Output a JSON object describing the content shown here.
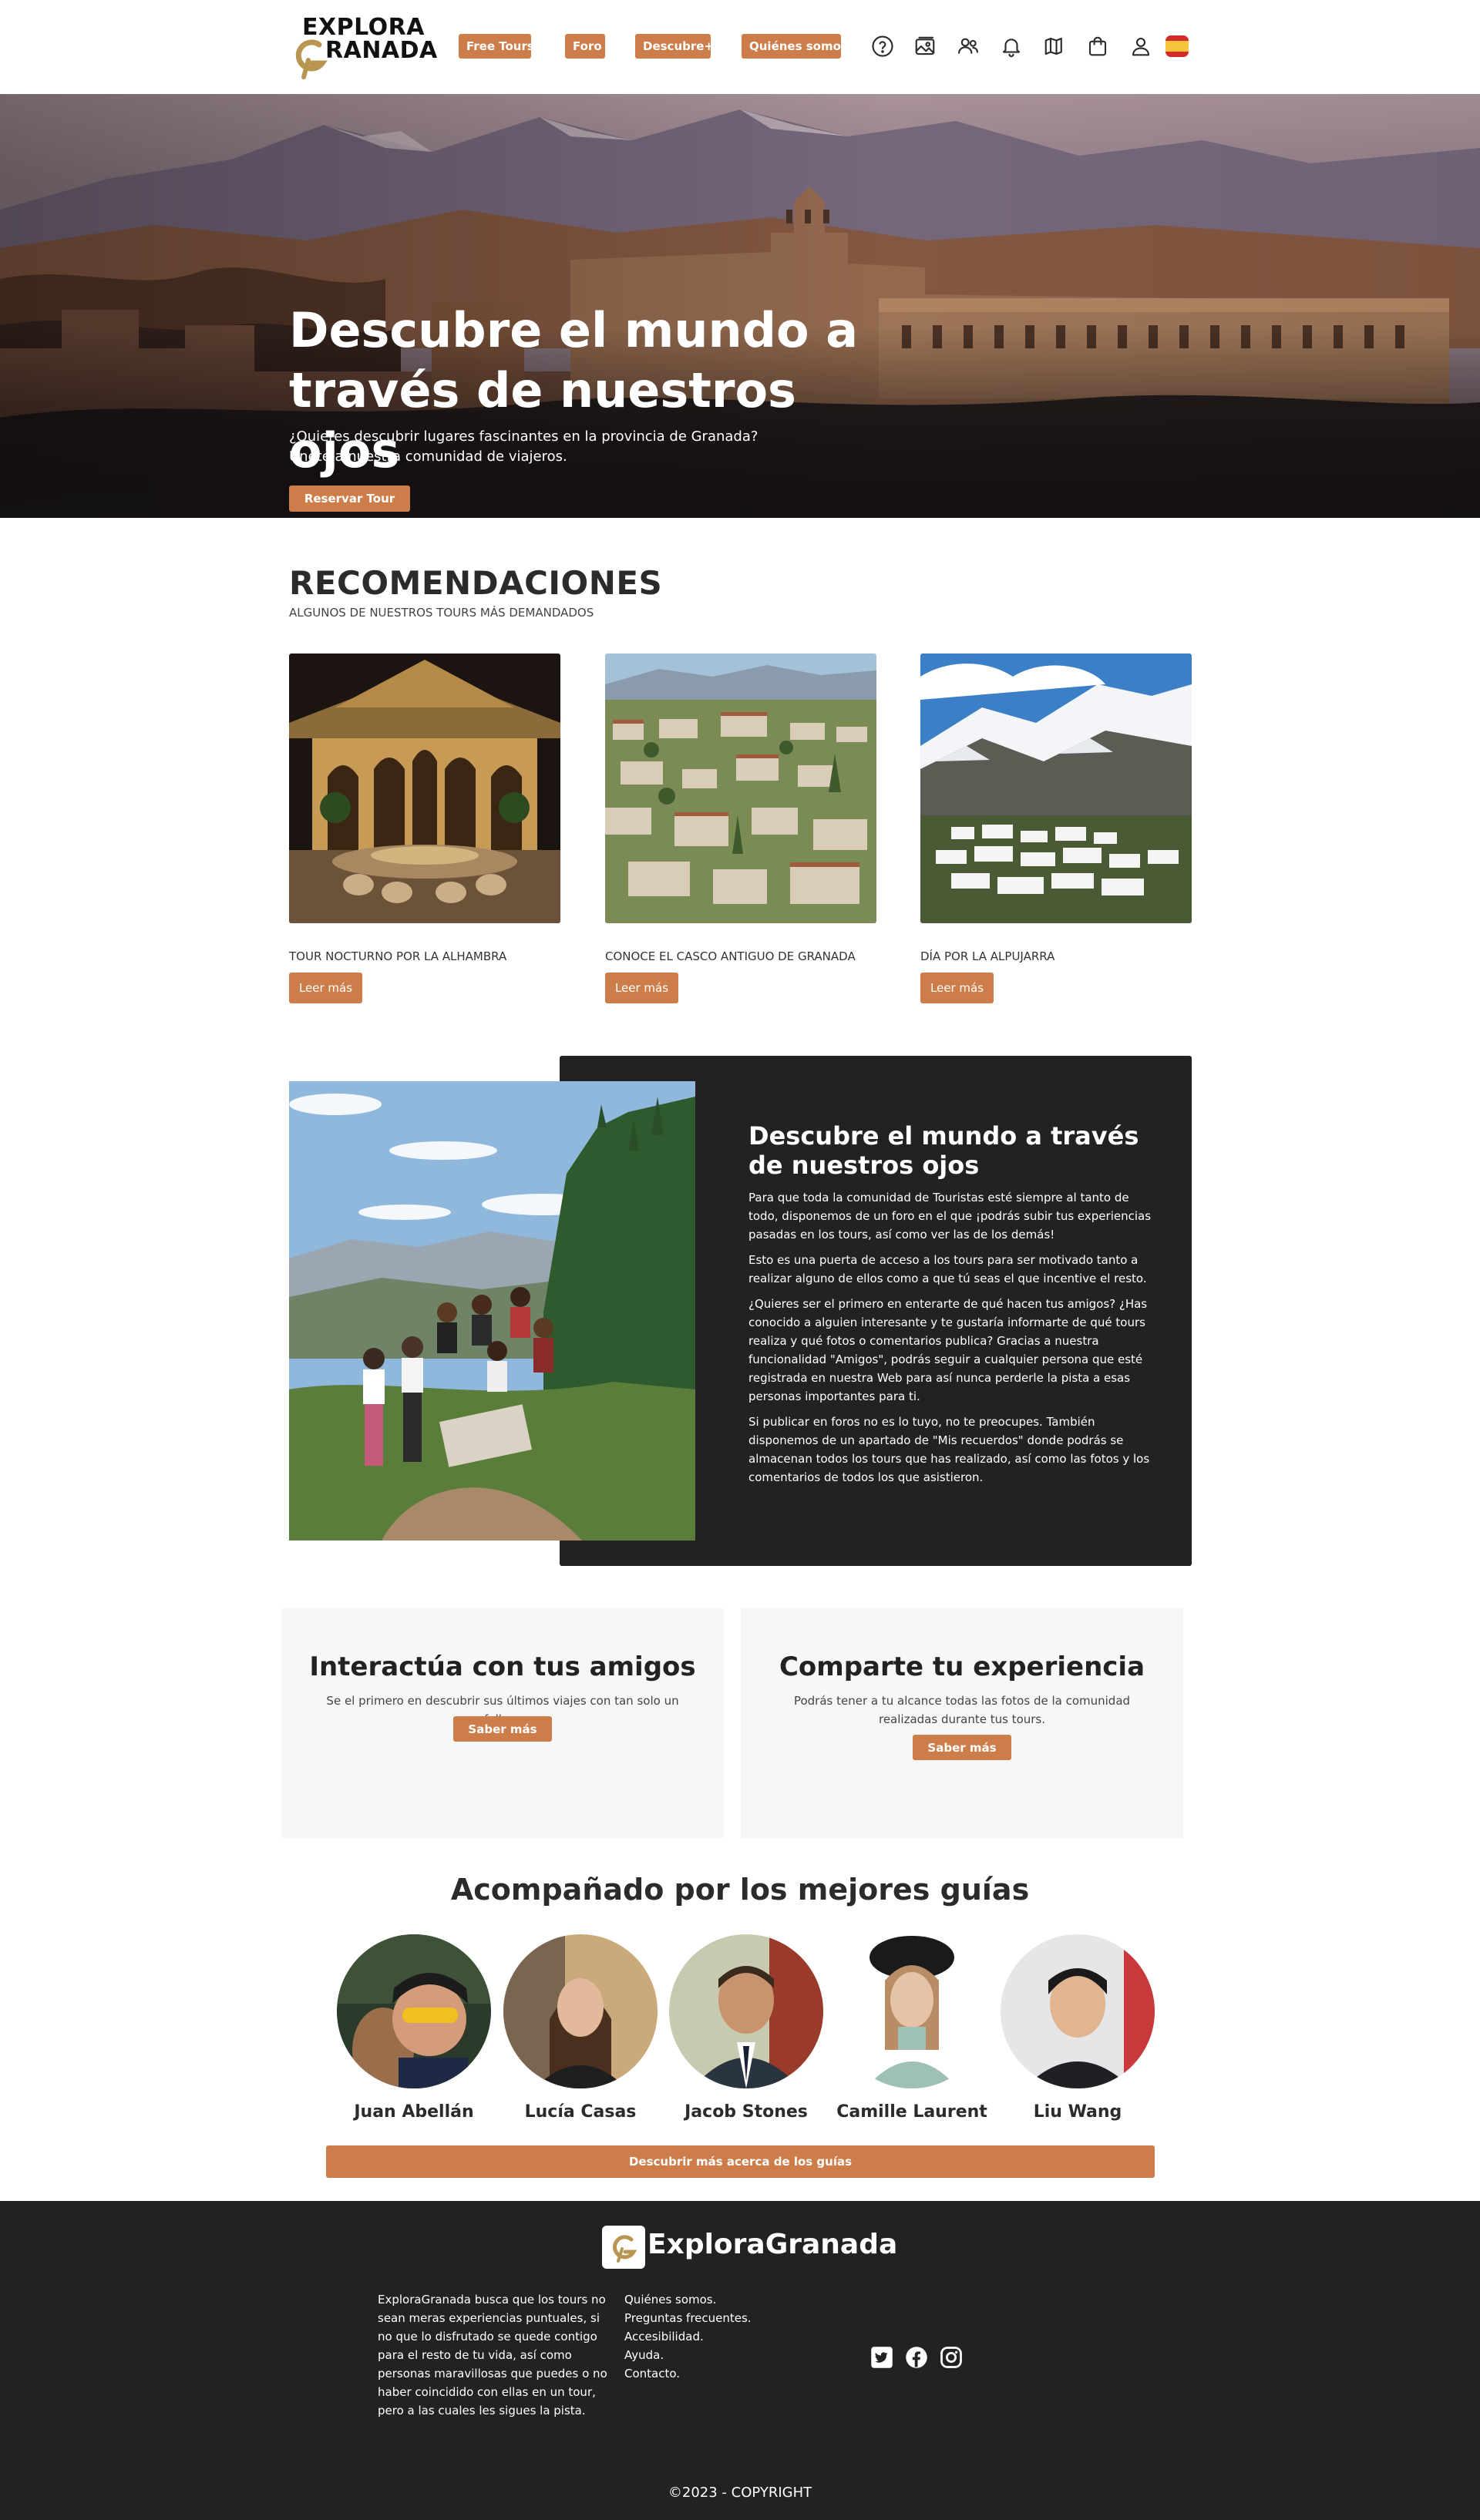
{
  "header": {
    "logo_line1": "EXPLORA",
    "logo_line2": "RANADA",
    "nav": [
      "Free Tours",
      "Foro",
      "Descubre+",
      "Quiénes somos"
    ],
    "icons": [
      "help-icon",
      "gallery-icon",
      "friends-icon",
      "bell-icon",
      "map-icon",
      "shopping-bag-icon",
      "user-icon",
      "spain-flag-icon"
    ]
  },
  "hero": {
    "title": "Descubre el mundo a través de nuestros ojos",
    "subtitle_line1": "¿Quieres descubrir lugares fascinantes en la provincia de Granada?",
    "subtitle_line2": "Únete a nuestra comunidad de viajeros.",
    "button": "Reservar Tour"
  },
  "recommendations": {
    "title": "RECOMENDACIONES",
    "subtitle": "ALGUNOS DE NUESTROS TOURS MÁS DEMANDADOS",
    "cards": [
      {
        "label": "TOUR NOCTURNO POR LA ALHAMBRA",
        "button": "Leer más"
      },
      {
        "label": "CONOCE EL CASCO ANTIGUO DE GRANADA",
        "button": "Leer más"
      },
      {
        "label": "DÍA POR LA ALPUJARRA",
        "button": "Leer más"
      }
    ]
  },
  "feature": {
    "title": "Descubre el mundo a través de nuestros ojos",
    "paragraphs": [
      "Para que toda la comunidad de Touristas esté siempre al tanto de todo, disponemos de un foro en el que ¡podrás subir tus experiencias pasadas en los tours, así como ver las de los demás!",
      "Esto es una puerta de acceso a los tours para ser motivado tanto a realizar alguno de ellos como a que tú seas el que incentive el resto.",
      "¿Quieres ser el primero en enterarte de qué hacen tus amigos? ¿Has conocido a alguien interesante y te gustaría informarte de qué tours realiza y qué fotos o comentarios publica? Gracias a nuestra funcionalidad \"Amigos\", podrás seguir a cualquier persona que esté registrada en nuestra Web para así nunca perderle la pista a esas personas importantes para ti.",
      "Si publicar en foros no es lo tuyo, no te preocupes. También disponemos de un apartado de \"Mis recuerdos\" donde podrás se almacenan todos los tours que has realizado, así como las fotos y los comentarios de todos los que asistieron."
    ]
  },
  "info_cards": [
    {
      "title": "Interactúa con tus amigos",
      "body": "Se el primero en descubrir sus últimos viajes con tan solo un follow.",
      "button": "Saber más"
    },
    {
      "title": "Comparte tu experiencia",
      "body": "Podrás tener a tu alcance todas las fotos de la comunidad realizadas durante tus tours.",
      "button": "Saber más"
    }
  ],
  "guides": {
    "title": "Acompañado por los mejores guías",
    "people": [
      {
        "name": "Juan Abellán"
      },
      {
        "name": "Lucía Casas"
      },
      {
        "name": "Jacob Stones"
      },
      {
        "name": "Camille Laurent"
      },
      {
        "name": "Liu Wang"
      }
    ],
    "button": "Descubrir más acerca de los guías"
  },
  "footer": {
    "brand": "ExploraGranada",
    "about": "ExploraGranada busca que los tours no sean meras experiencias puntuales, si no que lo disfrutado se quede contigo para el resto de tu vida, así como personas maravillosas que puedes o no haber coincidido con ellas en un tour, pero a las cuales les sigues la pista.",
    "links": [
      "Quiénes somos.",
      "Preguntas frecuentes.",
      "Accesibilidad.",
      "Ayuda.",
      "Contacto."
    ],
    "social": [
      "twitter-icon",
      "facebook-icon",
      "instagram-icon"
    ],
    "copyright": "©2023 - COPYRIGHT"
  },
  "colors": {
    "accent": "#cd7d49",
    "dark": "#232122",
    "light_card": "#f7f7f7"
  }
}
